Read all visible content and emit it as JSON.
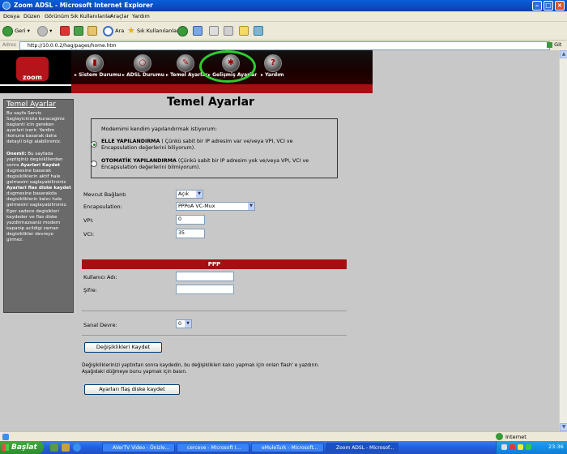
{
  "window": {
    "title": "Zoom ADSL - Microsoft Internet Explorer",
    "min_icon": "minimize-icon",
    "max_icon": "maximize-icon",
    "close_icon": "close-icon"
  },
  "menu": [
    "Dosya",
    "Düzen",
    "Görünüm",
    "Sık Kullanılanlar",
    "Araçlar",
    "Yardım"
  ],
  "toolbar": {
    "back": "Geri",
    "search": "Ara",
    "favorites": "Sık Kullanılanlar"
  },
  "address": {
    "label": "Adres",
    "url": "http://10.0.0.2/hag/pages/home.htm",
    "go": "Git"
  },
  "brand": {
    "logo": "zoom",
    "accent": "#a50f12",
    "highlight_ring": "#2ecc2e"
  },
  "nav": [
    {
      "label": "Sistem Durumu",
      "icon": "system-status-icon"
    },
    {
      "label": "ADSL Durumu",
      "icon": "magnifier-icon"
    },
    {
      "label": "Temel Ayarlar",
      "icon": "pencil-icon"
    },
    {
      "label": "Gelişmiş Ayarlar",
      "icon": "wrench-icon"
    },
    {
      "label": "Yardım",
      "icon": "help-icon"
    }
  ],
  "sidebar": {
    "title": "Temel Ayarlar",
    "para1": "Bu sayfa Servis Saglayicinizla kuracaginiz baglanti icin gereken ayarlari icerir. Yardim ikonuna basarak daha detayli bilgi alabilirsiniz.",
    "p2_b1": "Onemli:",
    "p2_t1": " Bu sayfada yaptiginiz degisiklilerden sonra ",
    "p2_b2": "Ayarlari Kaydet",
    "p2_t2": " dugmesine basarak degisikliklerin aktif hale gelmesini saglayabilirsiniz ",
    "p2_b3": "Ayarlari flas diske kaydet",
    "p2_t3": " dugmesine basarakda degisikliklerin kalıcı hale gelmesini saglayabilirsiniz. Eger sadece degisikleri kaydeder ve flas diske yazdirmazsaniz modem kapanip acildigi zaman degisiklikler devreye girmez."
  },
  "main": {
    "title": "Temel Ayarlar",
    "config_intro": "Modemimi kendim yapılandırmak istiyorum:",
    "opt_manual_bold": "ELLE YAPILANDIRMA",
    "opt_manual_text": " ( Çünkü sabit bir IP adresim var ve/veya VPI, VCI ve Encapsulation değerlerini biliyorum).",
    "opt_auto_bold": "OTOMATİK YAPILANDIRMA",
    "opt_auto_text": " (Çünkü sabit bir IP adresim yok ve/veya VPI, VCI ve Encapsulation değerlerini bilmiyorum).",
    "selected_option": "manual",
    "fields": {
      "connection_label": "Mevcut Bağlantı",
      "connection_value": "Açık",
      "encapsulation_label": "Encapsulation:",
      "encapsulation_value": "PPPoA VC-Mux",
      "vpi_label": "VPI:",
      "vpi_value": "0",
      "vci_label": "VCI:",
      "vci_value": "35"
    },
    "ppp": {
      "header": "PPP",
      "username_label": "Kullanıcı Adı:",
      "username_value": "",
      "password_label": "Şifre:",
      "password_value": ""
    },
    "virtual_circuit_label": "Sanal Devre:",
    "virtual_circuit_value": "0",
    "save_button": "Değişiklikleri Kaydet",
    "note_line1": "Değişikliklerinizi yaptıktan sonra kaydedin, bu değişiklikleri kalıcı yapmak için onları flash' e yazdırın.",
    "note_line2": "Aşağıdaki düğmeye bunu yapmak için basın.",
    "flash_button": "Ayarları flaş diske kaydet"
  },
  "status": {
    "zone": "Internet"
  },
  "taskbar": {
    "start": "Başlat",
    "tasks": [
      {
        "label": "AVerTV Video - Önizle..."
      },
      {
        "label": "cerceve - Microsoft I..."
      },
      {
        "label": "eMuleTurk - Microsoft..."
      },
      {
        "label": "Zoom ADSL - Microsof...",
        "active": true
      }
    ],
    "clock": "23:36"
  }
}
